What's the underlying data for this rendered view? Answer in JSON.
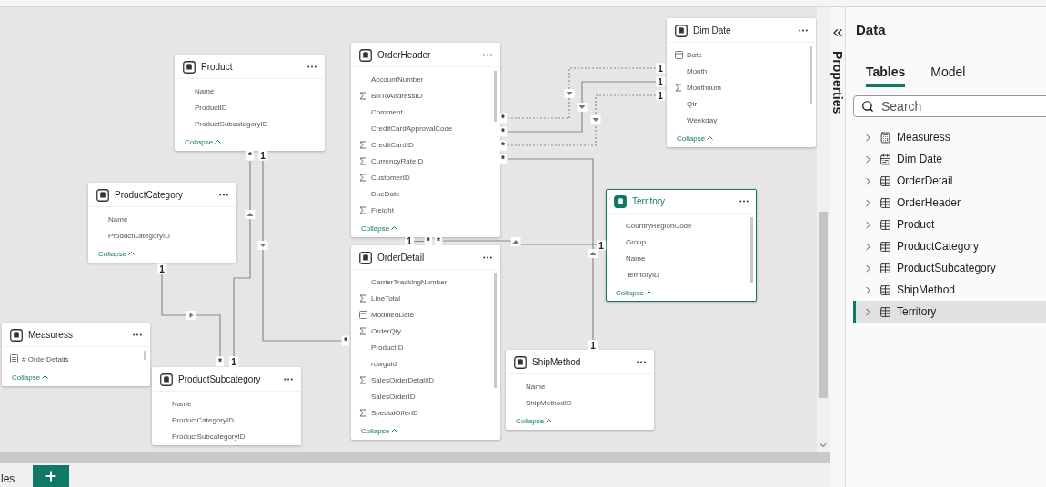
{
  "canvas": {
    "tables": [
      {
        "name": "Product",
        "selected": false,
        "collapse_label": "Collapse",
        "fields": [
          {
            "name": "Name",
            "kind": "text"
          },
          {
            "name": "ProductID",
            "kind": "text"
          },
          {
            "name": "ProductSubcategoryID",
            "kind": "text"
          }
        ]
      },
      {
        "name": "ProductCategory",
        "selected": false,
        "collapse_label": "Collapse",
        "fields": [
          {
            "name": "Name",
            "kind": "text"
          },
          {
            "name": "ProductCategoryID",
            "kind": "text"
          }
        ]
      },
      {
        "name": "Measuress",
        "selected": false,
        "collapse_label": "Collapse",
        "fields": [
          {
            "name": "# OrderDetails",
            "kind": "measure"
          }
        ]
      },
      {
        "name": "ProductSubcategory",
        "selected": false,
        "fields": [
          {
            "name": "Name",
            "kind": "text"
          },
          {
            "name": "ProductCategoryID",
            "kind": "text"
          },
          {
            "name": "ProductSubcategoryID",
            "kind": "text"
          }
        ]
      },
      {
        "name": "OrderHeader",
        "selected": false,
        "collapse_label": "Collapse",
        "fields": [
          {
            "name": "AccountNumber",
            "kind": "text"
          },
          {
            "name": "BillToAddressID",
            "kind": "sum"
          },
          {
            "name": "Comment",
            "kind": "text"
          },
          {
            "name": "CreditCardApprovalCode",
            "kind": "text"
          },
          {
            "name": "CreditCardID",
            "kind": "sum"
          },
          {
            "name": "CurrencyRateID",
            "kind": "sum"
          },
          {
            "name": "CustomerID",
            "kind": "sum"
          },
          {
            "name": "DueDate",
            "kind": "text"
          },
          {
            "name": "Freight",
            "kind": "sum"
          }
        ]
      },
      {
        "name": "OrderDetail",
        "selected": false,
        "collapse_label": "Collapse",
        "fields": [
          {
            "name": "CarrierTrackingNumber",
            "kind": "text"
          },
          {
            "name": "LineTotal",
            "kind": "sum"
          },
          {
            "name": "ModifiedDate",
            "kind": "date"
          },
          {
            "name": "OrderQty",
            "kind": "sum"
          },
          {
            "name": "ProductID",
            "kind": "text"
          },
          {
            "name": "rowguid",
            "kind": "text"
          },
          {
            "name": "SalesOrderDetailID",
            "kind": "sum"
          },
          {
            "name": "SalesOrderID",
            "kind": "text"
          },
          {
            "name": "SpecialOfferID",
            "kind": "sum"
          }
        ]
      },
      {
        "name": "Dim Date",
        "selected": false,
        "collapse_label": "Collapse",
        "fields": [
          {
            "name": "Date",
            "kind": "date"
          },
          {
            "name": "Month",
            "kind": "text"
          },
          {
            "name": "Monthnum",
            "kind": "sum"
          },
          {
            "name": "Qtr",
            "kind": "text"
          },
          {
            "name": "Weekday",
            "kind": "text"
          }
        ]
      },
      {
        "name": "Territory",
        "selected": true,
        "collapse_label": "Collapse",
        "fields": [
          {
            "name": "CountryRegionCode",
            "kind": "text"
          },
          {
            "name": "Group",
            "kind": "text"
          },
          {
            "name": "Name",
            "kind": "text"
          },
          {
            "name": "TerritoryID",
            "kind": "text"
          }
        ]
      },
      {
        "name": "ShipMethod",
        "selected": false,
        "collapse_label": "Collapse",
        "fields": [
          {
            "name": "Name",
            "kind": "text"
          },
          {
            "name": "ShipMethodID",
            "kind": "text"
          }
        ]
      }
    ],
    "relationships": [
      {
        "from_label": "*",
        "to_label": "1",
        "active": false
      },
      {
        "from_label": "*",
        "to_label": "1",
        "active": true
      },
      {
        "from_label": "*",
        "to_label": "1",
        "active": false
      },
      {
        "from_label": "*",
        "to_label": "1",
        "active": true
      },
      {
        "from_label": "1",
        "to_label": "*",
        "active": true
      },
      {
        "from_label": "*",
        "to_label": "1",
        "active": true
      },
      {
        "from_label": "1",
        "to_label": "*",
        "active": true
      },
      {
        "from_label": "1",
        "to_label": "*"
      },
      {
        "from_label": "*",
        "to_label": "1",
        "active": true
      }
    ]
  },
  "properties_pane": {
    "label": "Properties"
  },
  "data_pane": {
    "title": "Data",
    "tabs": [
      {
        "label": "Tables",
        "selected": true
      },
      {
        "label": "Model",
        "selected": false
      }
    ],
    "search": {
      "placeholder": "Search"
    },
    "items": [
      {
        "label": "Measuress",
        "kind": "measure",
        "selected": false
      },
      {
        "label": "Dim Date",
        "kind": "date",
        "selected": false
      },
      {
        "label": "OrderDetail",
        "kind": "table",
        "selected": false
      },
      {
        "label": "OrderHeader",
        "kind": "table",
        "selected": false
      },
      {
        "label": "Product",
        "kind": "table",
        "selected": false
      },
      {
        "label": "ProductCategory",
        "kind": "table",
        "selected": false
      },
      {
        "label": "ProductSubcategory",
        "kind": "table",
        "selected": false
      },
      {
        "label": "ShipMethod",
        "kind": "table",
        "selected": false
      },
      {
        "label": "Territory",
        "kind": "table",
        "selected": true
      }
    ]
  },
  "bottom_tabs": [
    {
      "label": "les"
    }
  ]
}
